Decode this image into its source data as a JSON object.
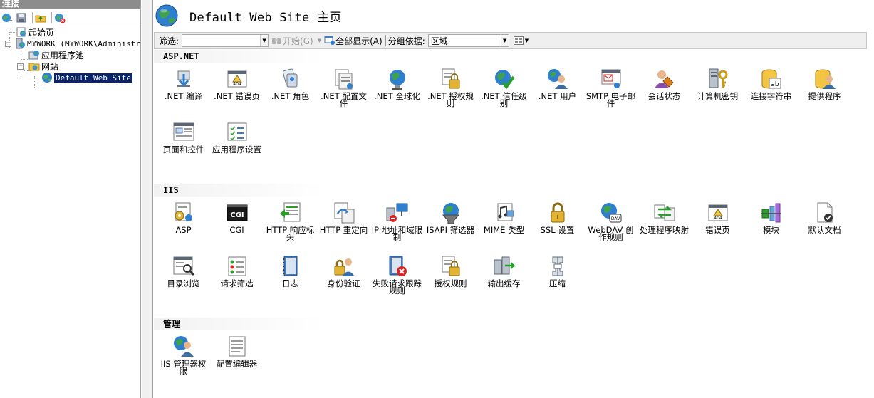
{
  "left_pane": {
    "header": "连接",
    "tree": [
      {
        "label": "起始页"
      },
      {
        "label": "MYWORK (MYWORK\\Administrat"
      },
      {
        "label": "应用程序池"
      },
      {
        "label": "网站"
      },
      {
        "label": "Default Web Site"
      }
    ]
  },
  "main": {
    "title": "Default Web Site 主页",
    "filter": {
      "label": "筛选:",
      "value": "",
      "go_label": "开始(G)",
      "show_all_label": "全部显示(A)",
      "group_label": "分组依据:",
      "group_value": "区域"
    },
    "sections": [
      {
        "title": "ASP.NET",
        "items": [
          {
            "label": ".NET 编译",
            "icon": "compile-icon"
          },
          {
            "label": ".NET 错误页",
            "icon": "error-page-404-icon"
          },
          {
            "label": ".NET 角色",
            "icon": "roles-icon"
          },
          {
            "label": ".NET 配置文件",
            "icon": "profile-icon"
          },
          {
            "label": ".NET 全球化",
            "icon": "globe-icon"
          },
          {
            "label": ".NET 授权规则",
            "icon": "lock-document-icon"
          },
          {
            "label": ".NET 信任级别",
            "icon": "globe-check-icon"
          },
          {
            "label": ".NET 用户",
            "icon": "users-globe-icon"
          },
          {
            "label": "SMTP 电子邮件",
            "icon": "email-icon"
          },
          {
            "label": "会话状态",
            "icon": "session-icon"
          },
          {
            "label": "计算机密钥",
            "icon": "machine-key-icon"
          },
          {
            "label": "连接字符串",
            "icon": "database-ab-icon"
          },
          {
            "label": "提供程序",
            "icon": "provider-icon"
          },
          {
            "label": "页面和控件",
            "icon": "pages-controls-icon"
          },
          {
            "label": "应用程序设置",
            "icon": "app-settings-icon"
          }
        ]
      },
      {
        "title": "IIS",
        "items": [
          {
            "label": "ASP",
            "icon": "asp-icon"
          },
          {
            "label": "CGI",
            "icon": "cgi-icon"
          },
          {
            "label": "HTTP 响应标头",
            "icon": "http-headers-icon"
          },
          {
            "label": "HTTP 重定向",
            "icon": "http-redirect-icon"
          },
          {
            "label": "IP 地址和域限制",
            "icon": "ip-restrict-icon"
          },
          {
            "label": "ISAPI 筛选器",
            "icon": "isapi-filter-icon"
          },
          {
            "label": "MIME 类型",
            "icon": "mime-icon"
          },
          {
            "label": "SSL 设置",
            "icon": "ssl-lock-icon"
          },
          {
            "label": "WebDAV 创作规则",
            "icon": "webdav-icon"
          },
          {
            "label": "处理程序映射",
            "icon": "handler-mapping-icon"
          },
          {
            "label": "错误页",
            "icon": "error-page-icon"
          },
          {
            "label": "模块",
            "icon": "modules-icon"
          },
          {
            "label": "默认文档",
            "icon": "default-document-icon"
          },
          {
            "label": "目录浏览",
            "icon": "directory-browse-icon"
          },
          {
            "label": "请求筛选",
            "icon": "request-filter-icon"
          },
          {
            "label": "日志",
            "icon": "logging-icon"
          },
          {
            "label": "身份验证",
            "icon": "authentication-icon"
          },
          {
            "label": "失败请求跟踪规则",
            "icon": "failed-request-icon"
          },
          {
            "label": "授权规则",
            "icon": "authorization-icon"
          },
          {
            "label": "输出缓存",
            "icon": "output-cache-icon"
          },
          {
            "label": "压缩",
            "icon": "compression-icon"
          }
        ]
      },
      {
        "title": "管理",
        "items": [
          {
            "label": "IIS 管理器权限",
            "icon": "manager-permissions-icon"
          },
          {
            "label": "配置编辑器",
            "icon": "config-editor-icon"
          }
        ]
      }
    ]
  },
  "colors": {
    "selection": "#0a246a",
    "pane_header": "#8c8c8c",
    "toolbar_bg": "#efefef"
  }
}
